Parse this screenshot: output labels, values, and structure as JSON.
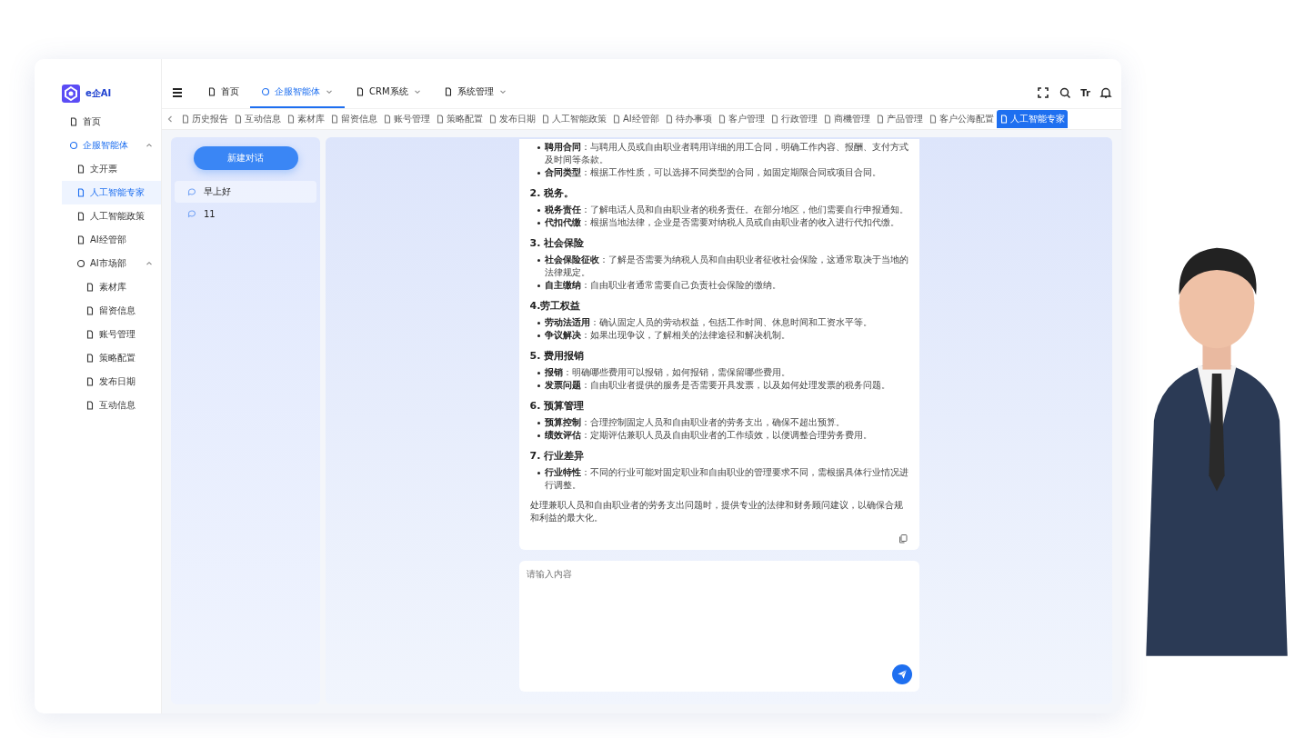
{
  "app": {
    "logo_text": "e企AI"
  },
  "sidebar": {
    "items": [
      {
        "label": "首页",
        "active": false,
        "selected": false
      },
      {
        "label": "企服智能体",
        "active": true,
        "selected": false,
        "expanded": true,
        "children": [
          {
            "label": "文开票",
            "selected": false
          },
          {
            "label": "人工智能专家",
            "selected": true
          },
          {
            "label": "人工智能政策",
            "selected": false
          },
          {
            "label": "AI经管部",
            "selected": false
          },
          {
            "label": "AI市场部",
            "selected": false,
            "expanded": true,
            "children": [
              {
                "label": "素材库",
                "selected": false
              },
              {
                "label": "留资信息",
                "selected": false
              },
              {
                "label": "账号管理",
                "selected": false
              },
              {
                "label": "策略配置",
                "selected": false
              },
              {
                "label": "发布日期",
                "selected": false
              },
              {
                "label": "互动信息",
                "selected": false
              }
            ]
          }
        ]
      }
    ]
  },
  "nav": {
    "items": [
      {
        "label": "首页",
        "selected": false,
        "dropdown": false
      },
      {
        "label": "企服智能体",
        "selected": true,
        "dropdown": true
      },
      {
        "label": "CRM系统",
        "selected": false,
        "dropdown": true
      },
      {
        "label": "系统管理",
        "selected": false,
        "dropdown": true
      }
    ]
  },
  "tools": {
    "font_size_label": "Tr"
  },
  "tabs": [
    {
      "label": "历史报告",
      "selected": false
    },
    {
      "label": "互动信息",
      "selected": false
    },
    {
      "label": "素材库",
      "selected": false
    },
    {
      "label": "留资信息",
      "selected": false
    },
    {
      "label": "账号管理",
      "selected": false
    },
    {
      "label": "策略配置",
      "selected": false
    },
    {
      "label": "发布日期",
      "selected": false
    },
    {
      "label": "人工智能政策",
      "selected": false
    },
    {
      "label": "AI经管部",
      "selected": false
    },
    {
      "label": "待办事项",
      "selected": false
    },
    {
      "label": "客户管理",
      "selected": false
    },
    {
      "label": "行政管理",
      "selected": false
    },
    {
      "label": "商機管理",
      "selected": false
    },
    {
      "label": "产品管理",
      "selected": false
    },
    {
      "label": "客户公海配置",
      "selected": false
    },
    {
      "label": "人工智能专家",
      "selected": true
    }
  ],
  "conversations": {
    "new_button": "新建对话",
    "items": [
      {
        "title": "早上好",
        "selected": true
      },
      {
        "title": "11",
        "selected": false
      }
    ]
  },
  "message": {
    "blocks": [
      {
        "kind": "bullets",
        "items": [
          "**聘用合同**：与聘用人员或自由职业者聘用详细的用工合同，明确工作内容、报酬、支付方式及时间等条款。",
          "**合同类型**：根据工作性质，可以选择不同类型的合同，如固定期限合同或项目合同。"
        ]
      },
      {
        "kind": "heading",
        "text": "2. 税务。"
      },
      {
        "kind": "bullets",
        "items": [
          "**税务责任**：了解电话人员和自由职业者的税务责任。在部分地区，他们需要自行申报通知。",
          "**代扣代缴**：根据当地法律，企业是否需要对纳税人员或自由职业者的收入进行代扣代缴。"
        ]
      },
      {
        "kind": "heading",
        "text": "3. 社会保险"
      },
      {
        "kind": "bullets",
        "items": [
          "**社会保险征收**：了解是否需要为纳税人员和自由职业者征收社会保险，这通常取决于当地的法律规定。",
          "**自主缴纳**：自由职业者通常需要自己负责社会保险的缴纳。"
        ]
      },
      {
        "kind": "heading",
        "text": "4.劳工权益"
      },
      {
        "kind": "bullets",
        "items": [
          "**劳动法适用**：确认固定人员的劳动权益，包括工作时间、休息时间和工资水平等。",
          "**争议解决**：如果出现争议，了解相关的法律途径和解决机制。"
        ]
      },
      {
        "kind": "heading",
        "text": "5. 费用报销"
      },
      {
        "kind": "bullets",
        "items": [
          "**报销**：明确哪些费用可以报销，如何报销，需保留哪些费用。",
          "**发票问题**：自由职业者提供的服务是否需要开具发票，以及如何处理发票的税务问题。"
        ]
      },
      {
        "kind": "heading",
        "text": "6. 预算管理"
      },
      {
        "kind": "bullets",
        "items": [
          "**预算控制**：合理控制固定人员和自由职业者的劳务支出，确保不超出预算。",
          "**绩效评估**：定期评估兼职人员及自由职业者的工作绩效，以便调整合理劳务费用。"
        ]
      },
      {
        "kind": "heading",
        "text": "7. 行业差异"
      },
      {
        "kind": "bullets",
        "items": [
          "**行业特性**：不同的行业可能对固定职业和自由职业的管理要求不同，需根据具体行业情况进行调整。"
        ]
      },
      {
        "kind": "paragraph",
        "text": "处理兼职人员和自由职业者的劳务支出问题时，提供专业的法律和财务顾问建议，以确保合规和利益的最大化。"
      }
    ]
  },
  "composer": {
    "placeholder": "请输入内容"
  }
}
